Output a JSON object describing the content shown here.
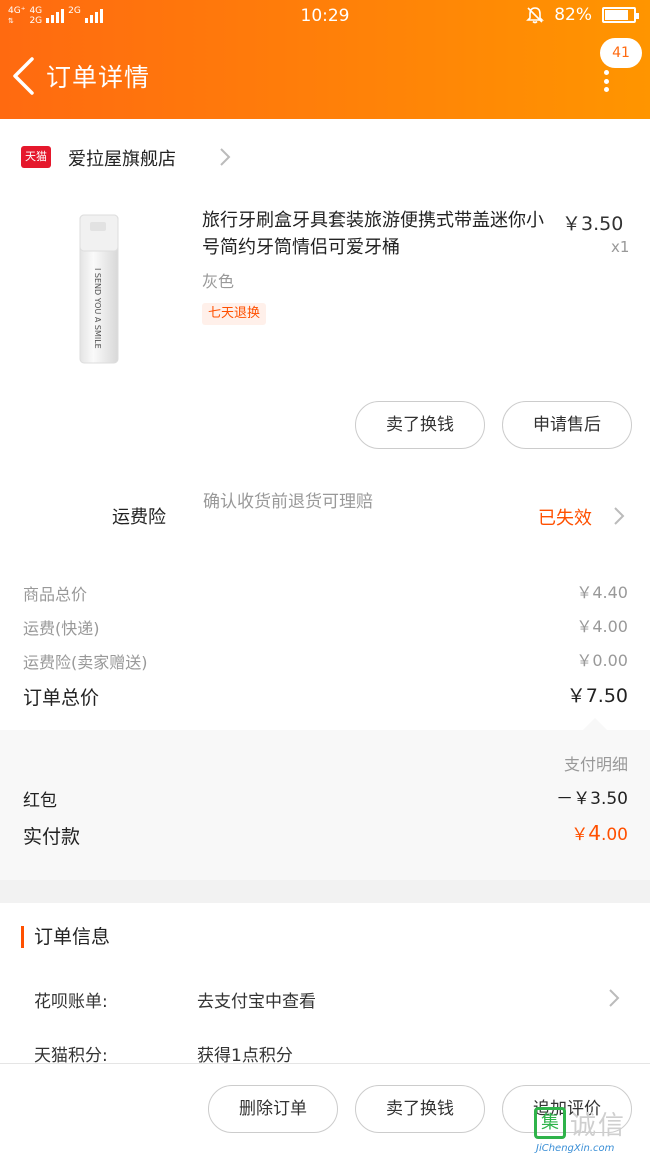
{
  "status_bar": {
    "net1": "4G⁺",
    "net1b": "4G",
    "net1c": "2G",
    "net2": "2G",
    "time": "10:29",
    "battery": "82%",
    "battery_level": 0.82
  },
  "header": {
    "title": "订单详情",
    "message_count": "41"
  },
  "shop": {
    "badge": "天猫",
    "name": "爱拉屋旗舰店"
  },
  "product": {
    "title": "旅行牙刷盒牙具套装旅游便携式带盖迷你小号简约牙筒情侣可爱牙桶",
    "price": "￥3.50",
    "quantity": "x1",
    "sku": "灰色",
    "tag": "七天退换",
    "image_text": "I SEND YOU A SMILE"
  },
  "product_actions": {
    "sell": "卖了换钱",
    "after_sale": "申请售后"
  },
  "freight_insurance": {
    "label": "运费险",
    "desc": "确认收货前退货可理赔",
    "status": "已失效"
  },
  "summary": {
    "goods_label": "商品总价",
    "goods_value": "￥4.40",
    "shipping_label": "运费(快递)",
    "shipping_value": "￥4.00",
    "insurance_label": "运费险(卖家赠送)",
    "insurance_value": "￥0.00",
    "total_label": "订单总价",
    "total_value": "￥7.50"
  },
  "payment": {
    "detail_label": "支付明细",
    "redpacket_label": "红包",
    "redpacket_value": "－￥3.50",
    "paid_label": "实付款",
    "paid_symbol": "￥",
    "paid_int": "4",
    "paid_dec": ".00"
  },
  "order_info": {
    "title": "订单信息",
    "huabei_label": "花呗账单:",
    "huabei_value": "去支付宝中查看",
    "points_label": "天猫积分:",
    "points_value": "获得1点积分"
  },
  "bottom_bar": {
    "delete": "删除订单",
    "sell": "卖了换钱",
    "review": "追加评价"
  },
  "watermark": {
    "box": "集",
    "cn": "诚信",
    "en": "JiChengXin.com"
  },
  "colors": {
    "accent": "#ff5000",
    "header_start": "#ff6a10",
    "header_end": "#ff9500",
    "tmall_red": "#e5182c"
  }
}
